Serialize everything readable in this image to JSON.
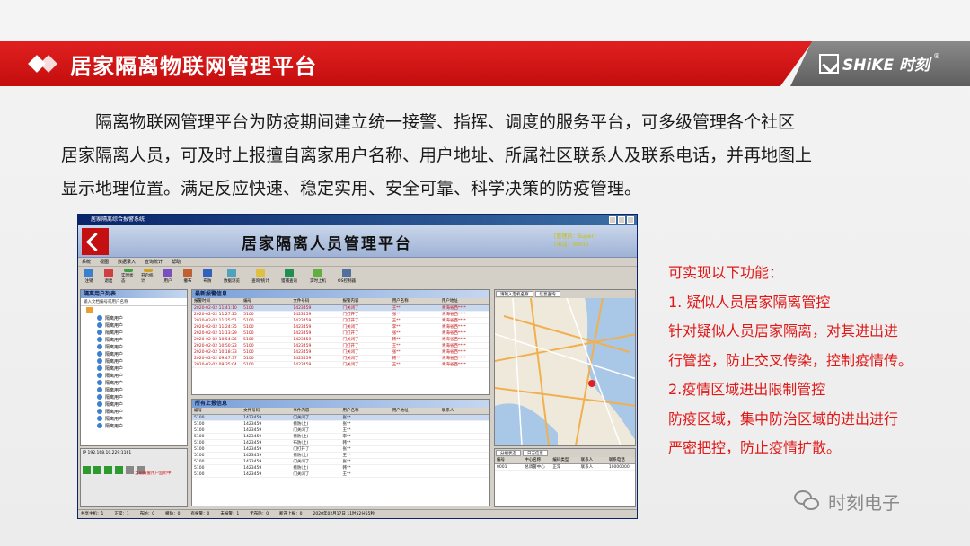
{
  "header": {
    "title": "居家隔离物联网管理平台",
    "brand": "SHiKE 时刻",
    "brand_reg": "®"
  },
  "intro": {
    "line1": "隔离物联网管理平台为防疫期间建立统一接警、指挥、调度的服务平台，可多级管理各个社区",
    "line2": "居家隔离人员，可及时上报擅自离家用户名称、用户地址、所属社区联系人及联系电话，并再地图上",
    "line3": "显示地理位置。满足反应快速、稳定实用、安全可靠、科学决策的防疫管理。"
  },
  "app": {
    "window_title": "居家隔离综合报警系统",
    "banner_title": "居家隔离人员管理平台",
    "user_line1": "[管理员：Super]",
    "user_line2": "[电话：0001]",
    "menu": [
      "系统",
      "视图",
      "数据录入",
      "查询统计",
      "帮助"
    ],
    "toolbar": [
      "注销",
      "退出",
      "实时状态",
      "开启统计",
      "用户",
      "撤布",
      "布防",
      "数据浏览",
      "查询/统计",
      "猎捕查询",
      "实时上机",
      "OS控制器"
    ],
    "tree_title": "隔离用户列表",
    "tree_search": "输入文档编号或用户名称",
    "tree_items": [
      "隔离用户",
      "隔离用户",
      "隔离用户",
      "隔离用户",
      "隔离用户",
      "隔离用户",
      "隔离用户",
      "隔离用户",
      "隔离用户",
      "隔离用户",
      "隔离用户",
      "隔离用户",
      "隔离用户",
      "隔离用户",
      "隔离用户",
      "隔离用户"
    ],
    "alarm_grid_title": "最新报警信息",
    "alarm_headers": [
      "报警时间",
      "编号",
      "文件号码",
      "报警内容",
      "用户名称",
      "用户地址"
    ],
    "alarm_rows": [
      [
        "2020-02-02 11:41:10",
        "5100",
        "1423459",
        "门关闭了",
        "王**",
        "青海省西****"
      ],
      [
        "2020-02-02 11:27:25",
        "5100",
        "1423459",
        "门打开了",
        "张**",
        "青海省西****"
      ],
      [
        "2020-02-02 11:25:51",
        "5100",
        "1423459",
        "门打开了",
        "王**",
        "青海省西****"
      ],
      [
        "2020-02-02 11:24:35",
        "5100",
        "1423459",
        "门关闭了",
        "李**",
        "青海省西****"
      ],
      [
        "2020-02-02 11:13:29",
        "5100",
        "1423459",
        "门打开了",
        "张**",
        "青海省西****"
      ],
      [
        "2020-02-02 10:54:26",
        "5100",
        "1423459",
        "门关闭了",
        "韩**",
        "青海省西****"
      ],
      [
        "2020-02-02 10:50:23",
        "5100",
        "1423459",
        "门打开了",
        "王**",
        "青海省西****"
      ],
      [
        "2020-02-02 10:18:33",
        "5100",
        "1423459",
        "门关闭了",
        "张**",
        "青海省西****"
      ],
      [
        "2020-02-02 09:47:37",
        "5100",
        "1423459",
        "门关闭了",
        "韩**",
        "青海省西****"
      ],
      [
        "2020-02-02 09:35:04",
        "5100",
        "1423459",
        "门关闭了",
        "王**",
        "青海省西****"
      ]
    ],
    "status_grid_title": "所有上报信息",
    "status_headers": [
      "编号",
      "文件号码",
      "事件内容",
      "用户名称",
      "用户地址",
      "联系人"
    ],
    "status_rows": [
      [
        "5100",
        "1423459",
        "门关闭了",
        "张**",
        "",
        ""
      ],
      [
        "5100",
        "1423459",
        "撤防(上)",
        "张**",
        "",
        ""
      ],
      [
        "5100",
        "1423459",
        "门关闭了",
        "王**",
        "",
        ""
      ],
      [
        "5100",
        "1423459",
        "撤防(上)",
        "李**",
        "",
        ""
      ],
      [
        "5100",
        "1423459",
        "布防(上)",
        "韩**",
        "",
        ""
      ],
      [
        "5100",
        "1423459",
        "门打开了",
        "张**",
        "",
        ""
      ],
      [
        "5100",
        "1423459",
        "撤防(上)",
        "王**",
        "",
        ""
      ],
      [
        "5100",
        "1423459",
        "门关闭了",
        "张**",
        "",
        ""
      ],
      [
        "5100",
        "1423459",
        "撤防(上)",
        "韩**",
        "",
        ""
      ],
      [
        "5100",
        "1423459",
        "门关闭了",
        "王**",
        "",
        ""
      ]
    ],
    "map_tabs": [
      "请输入定机名称",
      "信息查询"
    ],
    "map_callout": "同在主机报警求救",
    "info_tabs": [
      "分组状态",
      "日志信息"
    ],
    "info_headers": [
      "编号",
      "中心名称",
      "编码类型",
      "联系人",
      "联系电话"
    ],
    "info_row": [
      "0001",
      "总调警中心",
      "正常",
      "联系人",
      "10000000"
    ],
    "status_ip": "IP 192.168.10.229:1161",
    "warn_text": "当前报警用户监听中",
    "statusbar": [
      "共享主机：1",
      "正常：1",
      "布防：0",
      "撤防：0",
      "有报警：0",
      "未报警：1",
      "无布防：0",
      "断开上报：0",
      "2020年02月17日 11时52分55秒"
    ]
  },
  "features": {
    "intro": "可实现以下功能：",
    "item1_title": "1. 疑似人员居家隔离管控",
    "item1_l1": "针对疑似人员居家隔离，对其进出进",
    "item1_l2": "行管控，防止交叉传染，控制疫情传。",
    "item2_title": "2.疫情区域进出限制管控",
    "item2_l1": "防疫区域，集中防治区域的进出进行",
    "item2_l2": "严密把控，防止疫情扩散。"
  },
  "watermark": {
    "text": "时刻电子"
  },
  "colors": {
    "accent_red": "#d41414",
    "feature_red": "#e01818",
    "banner_gray": "#6e6e6e"
  }
}
